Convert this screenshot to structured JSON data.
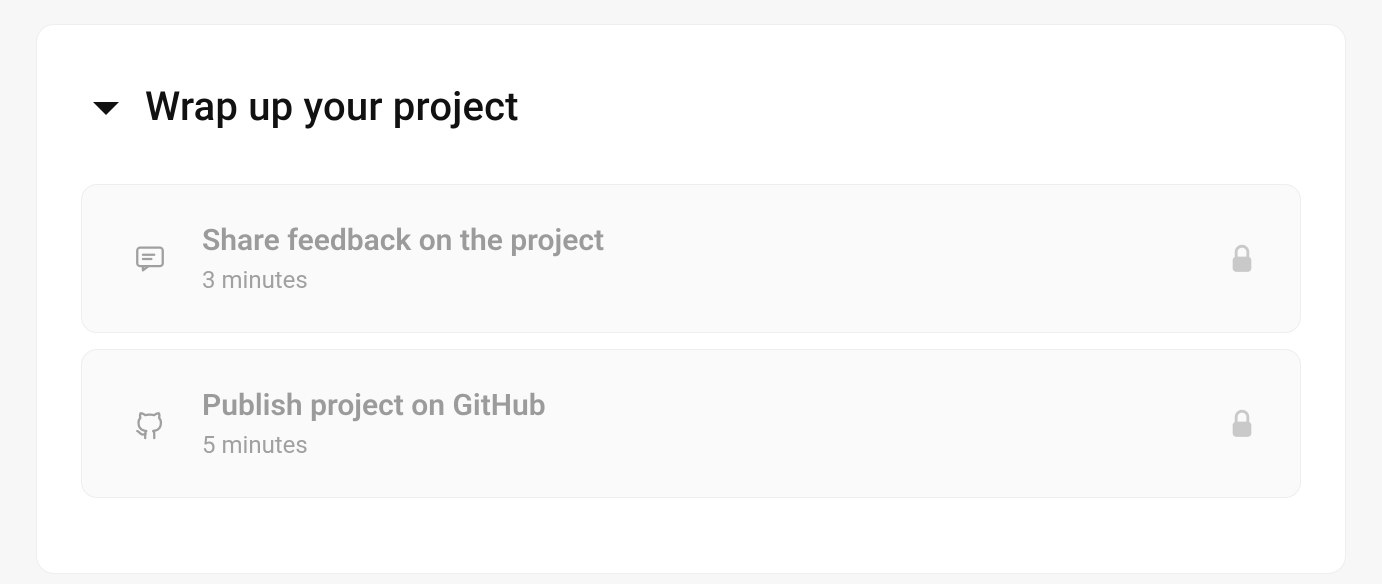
{
  "section": {
    "title": "Wrap up your project",
    "items": [
      {
        "title": "Share feedback on the project",
        "duration": "3 minutes",
        "icon": "comment",
        "locked": true
      },
      {
        "title": "Publish project on GitHub",
        "duration": "5 minutes",
        "icon": "github",
        "locked": true
      }
    ]
  }
}
